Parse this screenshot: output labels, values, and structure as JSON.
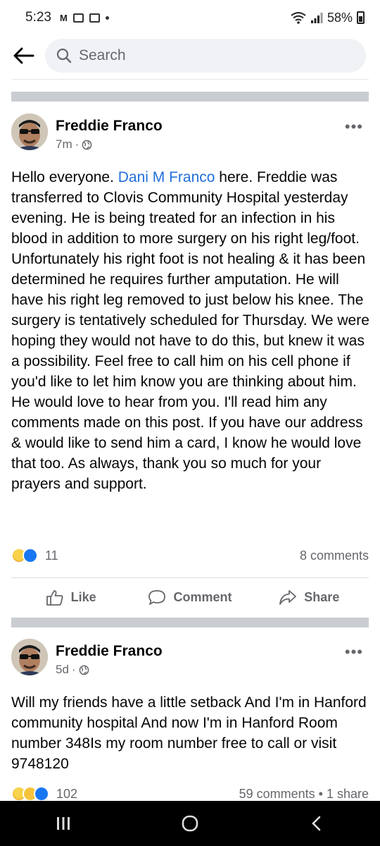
{
  "status_bar": {
    "time": "5:23",
    "battery": "58%"
  },
  "search": {
    "placeholder": "Search"
  },
  "posts": [
    {
      "author": "Freddie Franco",
      "time": "7m",
      "mention": "Dani M Franco",
      "text_before": "Hello everyone. ",
      "text_after": " here. Freddie was transferred to Clovis Community Hospital yesterday evening. He is being treated for an infection in his blood in addition to more surgery on his right leg/foot. Unfortunately his right foot is not healing & it has been determined he requires further amputation. He will have his right leg removed to just below his knee. The surgery is tentatively scheduled for Thursday. We were hoping they would not have to do this, but knew it was a possibility. Feel free to call him on his cell phone if you'd like to let him know you are thinking about him. He would love to hear from you. I'll read him any comments made on this post. If you have our address & would like to send him a card, I know he would love that too. As always, thank you so much for your prayers and support.",
      "reaction_count": "11",
      "comments": "8 comments"
    },
    {
      "author": "Freddie Franco",
      "time": "5d",
      "text": "Will my friends have a little setback And I'm in Hanford community hospital And now I'm in Hanford  Room number 348Is my room number free to call or visit 9748120",
      "reaction_count": "102",
      "comments": "59 comments",
      "shares": "1 share"
    }
  ],
  "actions": {
    "like": "Like",
    "comment": "Comment",
    "share": "Share"
  },
  "colors": {
    "accent": "#216fdb",
    "like_blue": "#1877f2",
    "muted_text": "#65676b",
    "separator": "#c9ccd1"
  }
}
